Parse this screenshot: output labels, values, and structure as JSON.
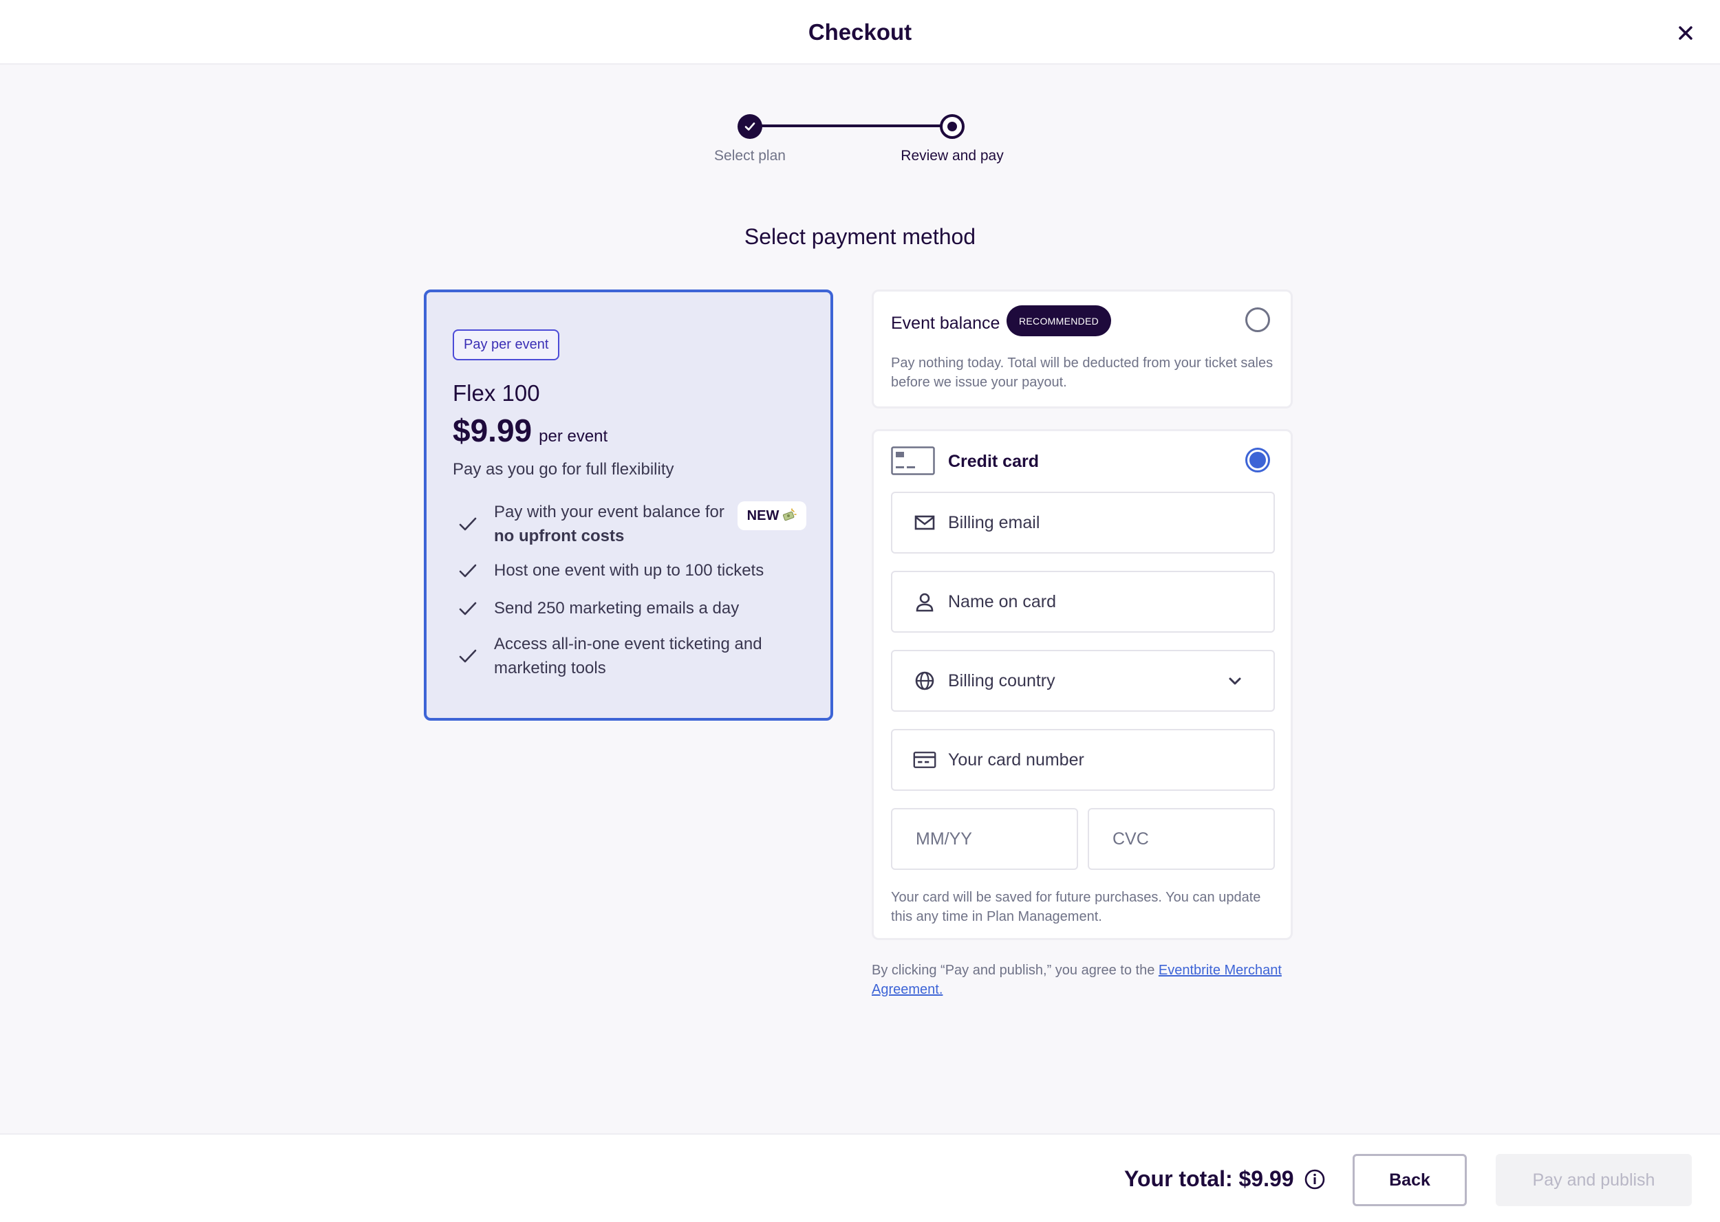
{
  "header": {
    "title": "Checkout",
    "close_icon": "close-icon"
  },
  "stepper": {
    "steps": [
      {
        "label": "Select plan",
        "state": "completed"
      },
      {
        "label": "Review and pay",
        "state": "current"
      }
    ]
  },
  "section_title": "Select payment method",
  "plan": {
    "badge": "Pay per event",
    "name": "Flex 100",
    "price": "$9.99",
    "price_unit": "per event",
    "description": "Pay as you go for full flexibility",
    "new_tag": "NEW",
    "features": [
      {
        "text": "Pay with your event balance for",
        "bold": "no upfront costs"
      },
      {
        "text": "Host one event with up to 100 tickets"
      },
      {
        "text": "Send 250 marketing emails a day"
      },
      {
        "text": "Access all-in-one event ticketing and",
        "line2": "marketing tools"
      }
    ]
  },
  "payment": {
    "event_balance": {
      "title": "Event balance",
      "badge": "RECOMMENDED",
      "description": "Pay nothing today. Total will be deducted from your ticket sales before we issue your payout.",
      "selected": false
    },
    "credit_card": {
      "title": "Credit card",
      "selected": true,
      "fields": {
        "billing_email": "Billing email",
        "name_on_card": "Name on card",
        "billing_country": "Billing country",
        "card_number": "Your card number",
        "expiry": "MM/YY",
        "cvc": "CVC"
      },
      "note": "Your card will be saved for future purchases. You can update this any time in Plan Management."
    }
  },
  "agreement": {
    "prefix": "By clicking “Pay and publish,” you agree to the ",
    "link": "Eventbrite Merchant Agreement."
  },
  "footer": {
    "total": "Your total: $9.99",
    "back_label": "Back",
    "pay_label": "Pay and publish"
  },
  "colors": {
    "brand_dark": "#1e0a3c",
    "accent_blue": "#3d64d6",
    "plan_bg": "#e8e9f6"
  }
}
